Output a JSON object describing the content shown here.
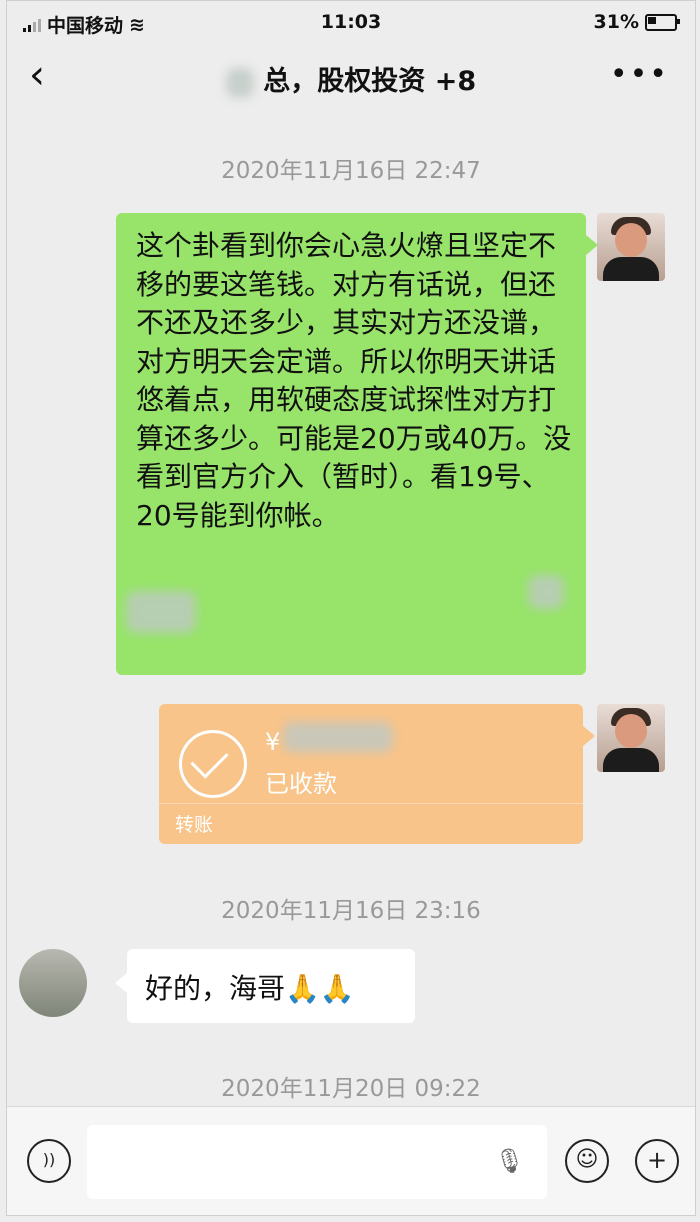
{
  "status_bar": {
    "carrier": "中国移动",
    "time": "11:03",
    "battery": "31%"
  },
  "nav": {
    "title": "总，股权投资 +8",
    "back_icon": "chevron-left",
    "more_icon": "ellipsis"
  },
  "timestamps": [
    "2020年11月16日 22:47",
    "2020年11月16日 23:16",
    "2020年11月20日 09:22"
  ],
  "messages": {
    "long_text": "这个卦看到你会心急火燎且坚定不移的要这笔钱。对方有话说，但还不还及还多少，其实对方还没谱，对方明天会定谱。所以你明天讲话悠着点，用软硬态度试探性对方打算还多少。可能是20万或40万。没看到官方介入（暂时）。看19号、20号能到你帐。",
    "transfer": {
      "currency": "¥",
      "status": "已收款",
      "label": "转账"
    },
    "reply": "好的，海哥🙏🙏"
  },
  "input_bar": {
    "voice_icon": "voice",
    "mic_icon": "microphone",
    "emoji_icon": "smiley",
    "plus_icon": "plus"
  }
}
